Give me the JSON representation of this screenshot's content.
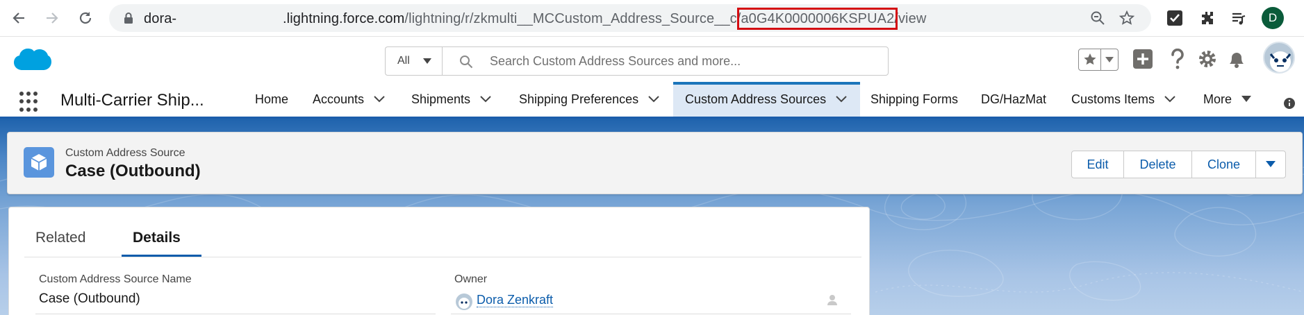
{
  "browser": {
    "url_prefix": "dora-",
    "url_host": ".lightning.force.com",
    "url_path_before": "/lightning/r/zkmulti__MCCustom_Address_Source__c/",
    "url_record_id": "a0G4K0000006KSPUA2",
    "url_path_after": "/view",
    "profile_initial": "D"
  },
  "global_header": {
    "search_scope": "All",
    "search_placeholder": "Search Custom Address Sources and more..."
  },
  "app_nav": {
    "app_name": "Multi-Carrier Ship...",
    "items": [
      {
        "label": "Home"
      },
      {
        "label": "Accounts"
      },
      {
        "label": "Shipments"
      },
      {
        "label": "Shipping Preferences"
      },
      {
        "label": "Custom Address Sources"
      },
      {
        "label": "Shipping Forms"
      },
      {
        "label": "DG/HazMat"
      },
      {
        "label": "Customs Items"
      },
      {
        "label": "More"
      }
    ]
  },
  "record": {
    "object_label": "Custom Address Source",
    "name": "Case (Outbound)",
    "actions": {
      "edit": "Edit",
      "delete": "Delete",
      "clone": "Clone"
    }
  },
  "details": {
    "tabs": {
      "related": "Related",
      "details": "Details"
    },
    "fields": {
      "name_label": "Custom Address Source Name",
      "name_value": "Case (Outbound)",
      "owner_label": "Owner",
      "owner_value": "Dora Zenkraft"
    }
  },
  "colors": {
    "accent_blue": "#0b5cab",
    "highlight_red": "#d40d12",
    "brand_blue": "#1b75bb"
  }
}
